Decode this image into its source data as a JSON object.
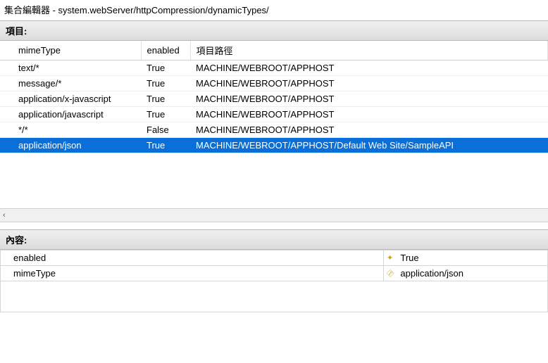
{
  "window": {
    "title": "集合編輯器 - system.webServer/httpCompression/dynamicTypes/"
  },
  "labels": {
    "items_header": "項目:",
    "content_header": "內容:",
    "scroll_left": "‹"
  },
  "grid": {
    "columns": {
      "mimeType": "mimeType",
      "enabled": "enabled",
      "path": "項目路徑"
    },
    "rows": [
      {
        "mimeType": "text/*",
        "enabled": "True",
        "path": "MACHINE/WEBROOT/APPHOST",
        "selected": false
      },
      {
        "mimeType": "message/*",
        "enabled": "True",
        "path": "MACHINE/WEBROOT/APPHOST",
        "selected": false
      },
      {
        "mimeType": "application/x-javascript",
        "enabled": "True",
        "path": "MACHINE/WEBROOT/APPHOST",
        "selected": false
      },
      {
        "mimeType": "application/javascript",
        "enabled": "True",
        "path": "MACHINE/WEBROOT/APPHOST",
        "selected": false
      },
      {
        "mimeType": "*/*",
        "enabled": "False",
        "path": "MACHINE/WEBROOT/APPHOST",
        "selected": false
      },
      {
        "mimeType": "application/json",
        "enabled": "True",
        "path": "MACHINE/WEBROOT/APPHOST/Default Web Site/SampleAPI",
        "selected": true
      }
    ]
  },
  "properties": {
    "rows": [
      {
        "name": "enabled",
        "value": "True",
        "icon": "star"
      },
      {
        "name": "mimeType",
        "value": "application/json",
        "icon": "key"
      }
    ]
  }
}
